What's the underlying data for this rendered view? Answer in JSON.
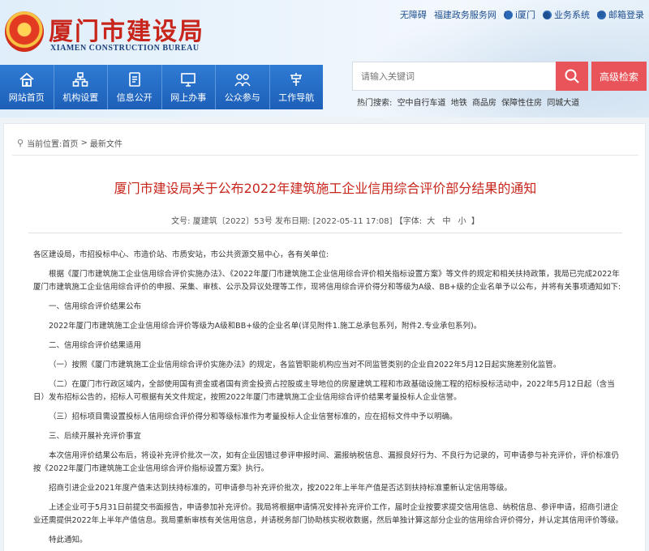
{
  "header": {
    "logo_cn": "厦门市建设局",
    "logo_en": "XIAMEN CONSTRUCTION BUREAU",
    "top_links": [
      "无障碍",
      "福建政务服务网",
      "i厦门",
      "业务系统",
      "邮箱登录"
    ]
  },
  "nav": [
    {
      "label": "网站首页",
      "icon": "home-icon"
    },
    {
      "label": "机构设置",
      "icon": "org-icon"
    },
    {
      "label": "信息公开",
      "icon": "doc-icon"
    },
    {
      "label": "网上办事",
      "icon": "computer-icon"
    },
    {
      "label": "公众参与",
      "icon": "people-icon"
    },
    {
      "label": "工作导航",
      "icon": "nav-icon"
    }
  ],
  "search": {
    "placeholder": "请输入关键词",
    "advanced_label": "高级检索",
    "hot_label": "热门搜索:",
    "hot_terms": [
      "空中自行车道",
      "地铁",
      "商品房",
      "保障性住房",
      "同城大道"
    ]
  },
  "breadcrumb": {
    "prefix": "当前位置:",
    "home": "首页",
    "sep": ">",
    "current": "最新文件"
  },
  "article": {
    "title": "厦门市建设局关于公布2022年建筑施工企业信用综合评价部分结果的通知",
    "meta_prefix": "文号: 厦建筑〔2022〕53号 发布日期: [2022-05-11 17:08] 【字体:",
    "font_sizes": [
      "大",
      "中",
      "小"
    ],
    "meta_suffix": "】",
    "paragraphs": [
      {
        "text": "各区建设局，市招投标中心、市造价站、市质安站，市公共资源交易中心，各有关单位:",
        "indent": false
      },
      {
        "text": "根据《厦门市建筑施工企业信用综合评价实施办法》、《2022年厦门市建筑施工企业信用综合评价相关指标设置方案》等文件的规定和相关扶持政策，我局已完成2022年厦门市建筑施工企业信用综合评价的申报、采集、审核、公示及异议处理等工作，现将信用综合评价得分和等级为A级、BB+级的企业名单予以公布，并将有关事项通知如下:",
        "indent": true
      },
      {
        "text": "一、信用综合评价结果公布",
        "indent": true
      },
      {
        "text": "2022年厦门市建筑施工企业信用综合评价等级为A级和BB+级的企业名单(详见附件1.施工总承包系列，附件2.专业承包系列)。",
        "indent": true
      },
      {
        "text": "二、信用综合评价结果适用",
        "indent": true
      },
      {
        "text": "（一）按照《厦门市建筑施工企业信用综合评价实施办法》的规定，各监管职能机构应当对不同监管类别的企业自2022年5月12日起实施差别化监管。",
        "indent": true
      },
      {
        "text": "（二）在厦门市行政区域内，全部使用国有资金或者国有资金投资占控股或主导地位的房屋建筑工程和市政基础设施工程的招标投标活动中，2022年5月12日起（含当日）发布招标公告的，招标人可根据有关文件规定，按照2022年厦门市建筑施工企业信用综合评价结果考量投标人企业信誉。",
        "indent": true
      },
      {
        "text": "（三）招标项目需设置投标人信用综合评价得分和等级标准作为考量投标人企业信誉标准的，应在招标文件中予以明确。",
        "indent": true
      },
      {
        "text": "三、后续开展补充评价事宜",
        "indent": true
      },
      {
        "text": "本次信用评价结果公布后，将设补充评价批次一次，如有企业因错过参评申报时间、漏报纳税信息、漏报良好行为、不良行为记录的，可申请参与补充评价，评价标准仍按《2022年厦门市建筑施工企业信用综合评价指标设置方案》执行。",
        "indent": true
      },
      {
        "text": "招商引进企业2021年度产值未达到扶持标准的，可申请参与补充评价批次，按2022年上半年产值是否达到扶持标准重新认定信用等级。",
        "indent": true
      },
      {
        "text": "上述企业可于5月31日前提交书面报告，申请参加补充评价。我局将根据申请情况安排补充评价工作，届时企业按要求提交信用信息、纳税信息、参评申请，招商引进企业还需提供2022年上半年产值信息。我局重新审核有关信用信息，并请税务部门协助核实税收数据，然后单独计算这部分企业的信用综合评价得分，并认定其信用评价等级。",
        "indent": true
      },
      {
        "text": "特此通知。",
        "indent": true
      }
    ]
  },
  "colors": {
    "nav_blue": "#1d5fb8",
    "title_red": "#c8261c",
    "search_red": "#e8545a"
  }
}
